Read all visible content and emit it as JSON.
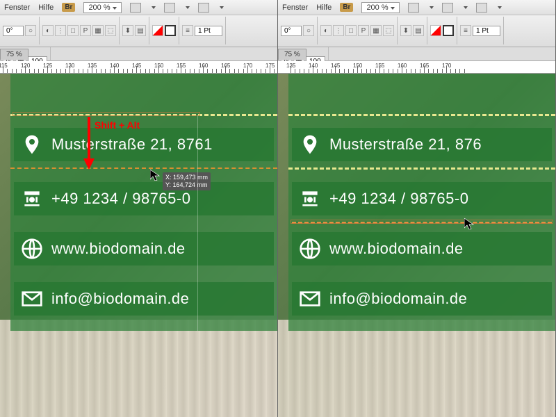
{
  "menu": {
    "window": "Fenster",
    "help": "Hilfe",
    "br": "Br",
    "zoom": "200 %"
  },
  "ctrl": {
    "rotation": "0°",
    "stroke": "1 Pt",
    "opacity": "100",
    "p": "P"
  },
  "tab": {
    "zoom_tab": "75 %"
  },
  "ruler_left": {
    "ticks": [
      "115",
      "120",
      "125",
      "130",
      "135",
      "140",
      "145",
      "150",
      "155",
      "160",
      "165",
      "170",
      "175"
    ]
  },
  "ruler_right": {
    "ticks": [
      "135",
      "140",
      "145",
      "150",
      "155",
      "160",
      "165",
      "170"
    ]
  },
  "contact": {
    "address": "Musterstraße 21, 8761",
    "address_r": "Musterstraße 21, 876",
    "phone": "+49 1234 / 98765-0",
    "web": "www.biodomain.de",
    "email": "info@biodomain.de"
  },
  "annotation": {
    "hint": "Shift + Alt",
    "xy_x": "X: 159,473 mm",
    "xy_y": "Y: 164,724 mm"
  }
}
